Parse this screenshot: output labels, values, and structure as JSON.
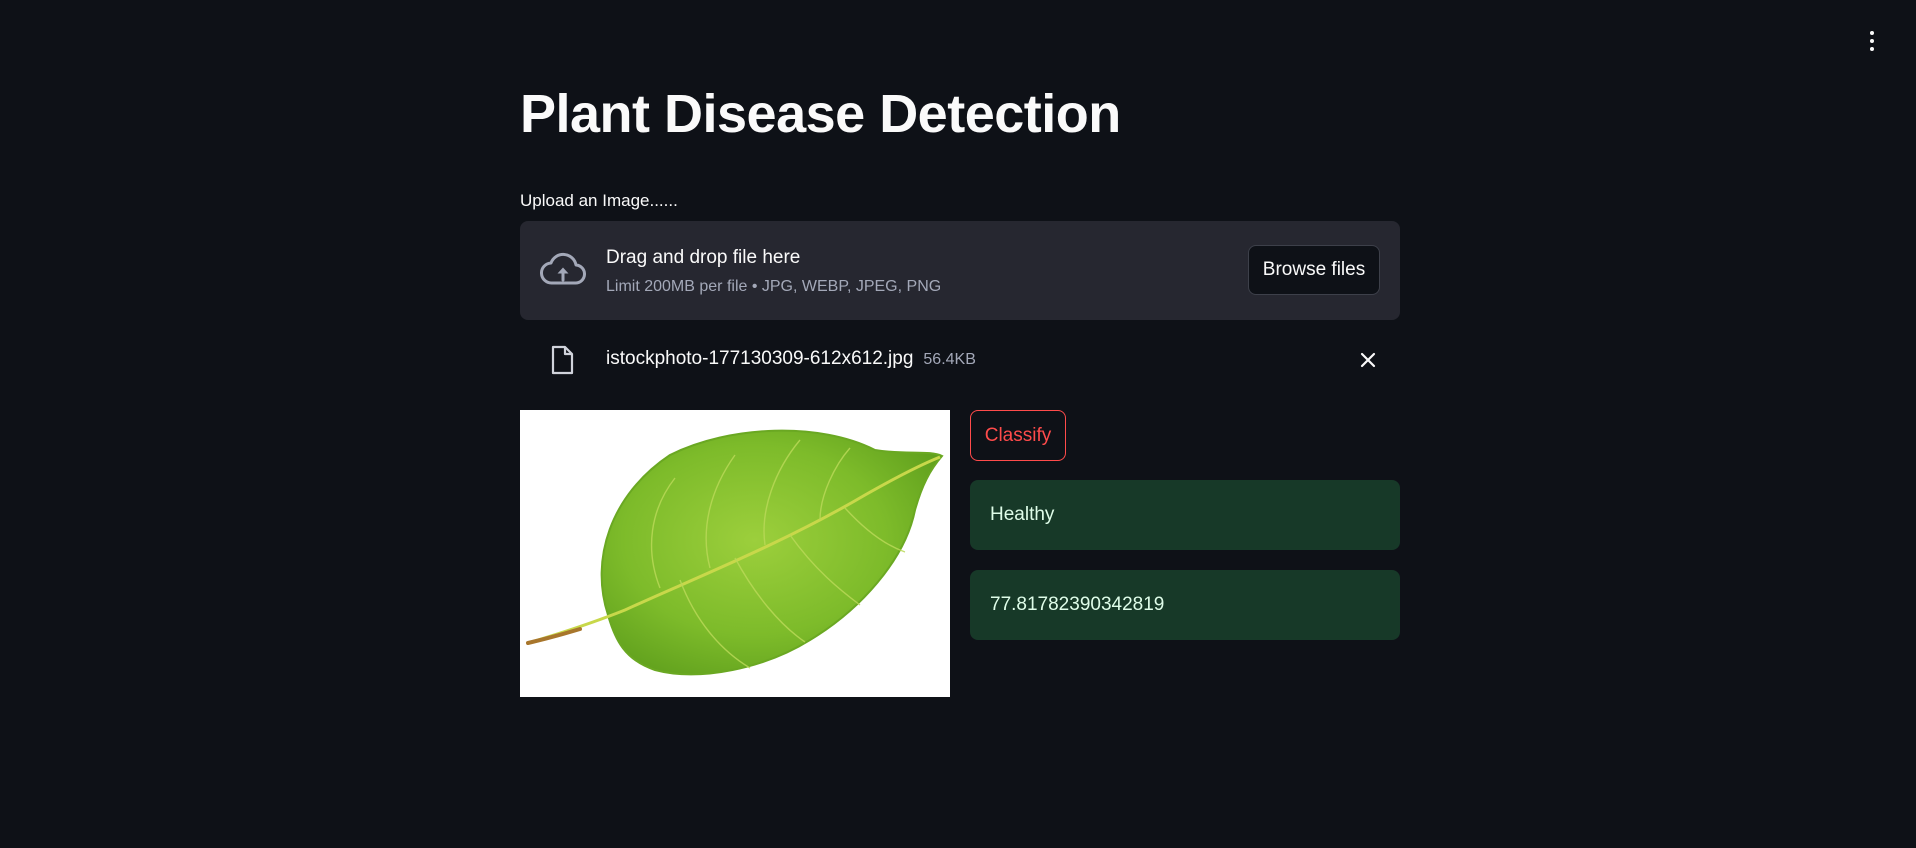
{
  "page": {
    "title": "Plant Disease Detection"
  },
  "uploader": {
    "label": "Upload an Image......",
    "dropzone_title": "Drag and drop file here",
    "dropzone_limit": "Limit 200MB per file • JPG, WEBP, JPEG, PNG",
    "browse_label": "Browse files",
    "icon": "cloud-upload-icon"
  },
  "uploaded_file": {
    "name": "istockphoto-177130309-612x612.jpg",
    "size": "56.4KB",
    "icon": "file-icon",
    "remove_icon": "close-icon"
  },
  "actions": {
    "classify_label": "Classify"
  },
  "results": {
    "prediction": "Healthy",
    "score": "77.81782390342819"
  },
  "colors": {
    "background": "#0e1117",
    "surface": "#262730",
    "accent": "#ff4b4b",
    "success_bg": "#173928",
    "success_text": "#dffde9"
  }
}
